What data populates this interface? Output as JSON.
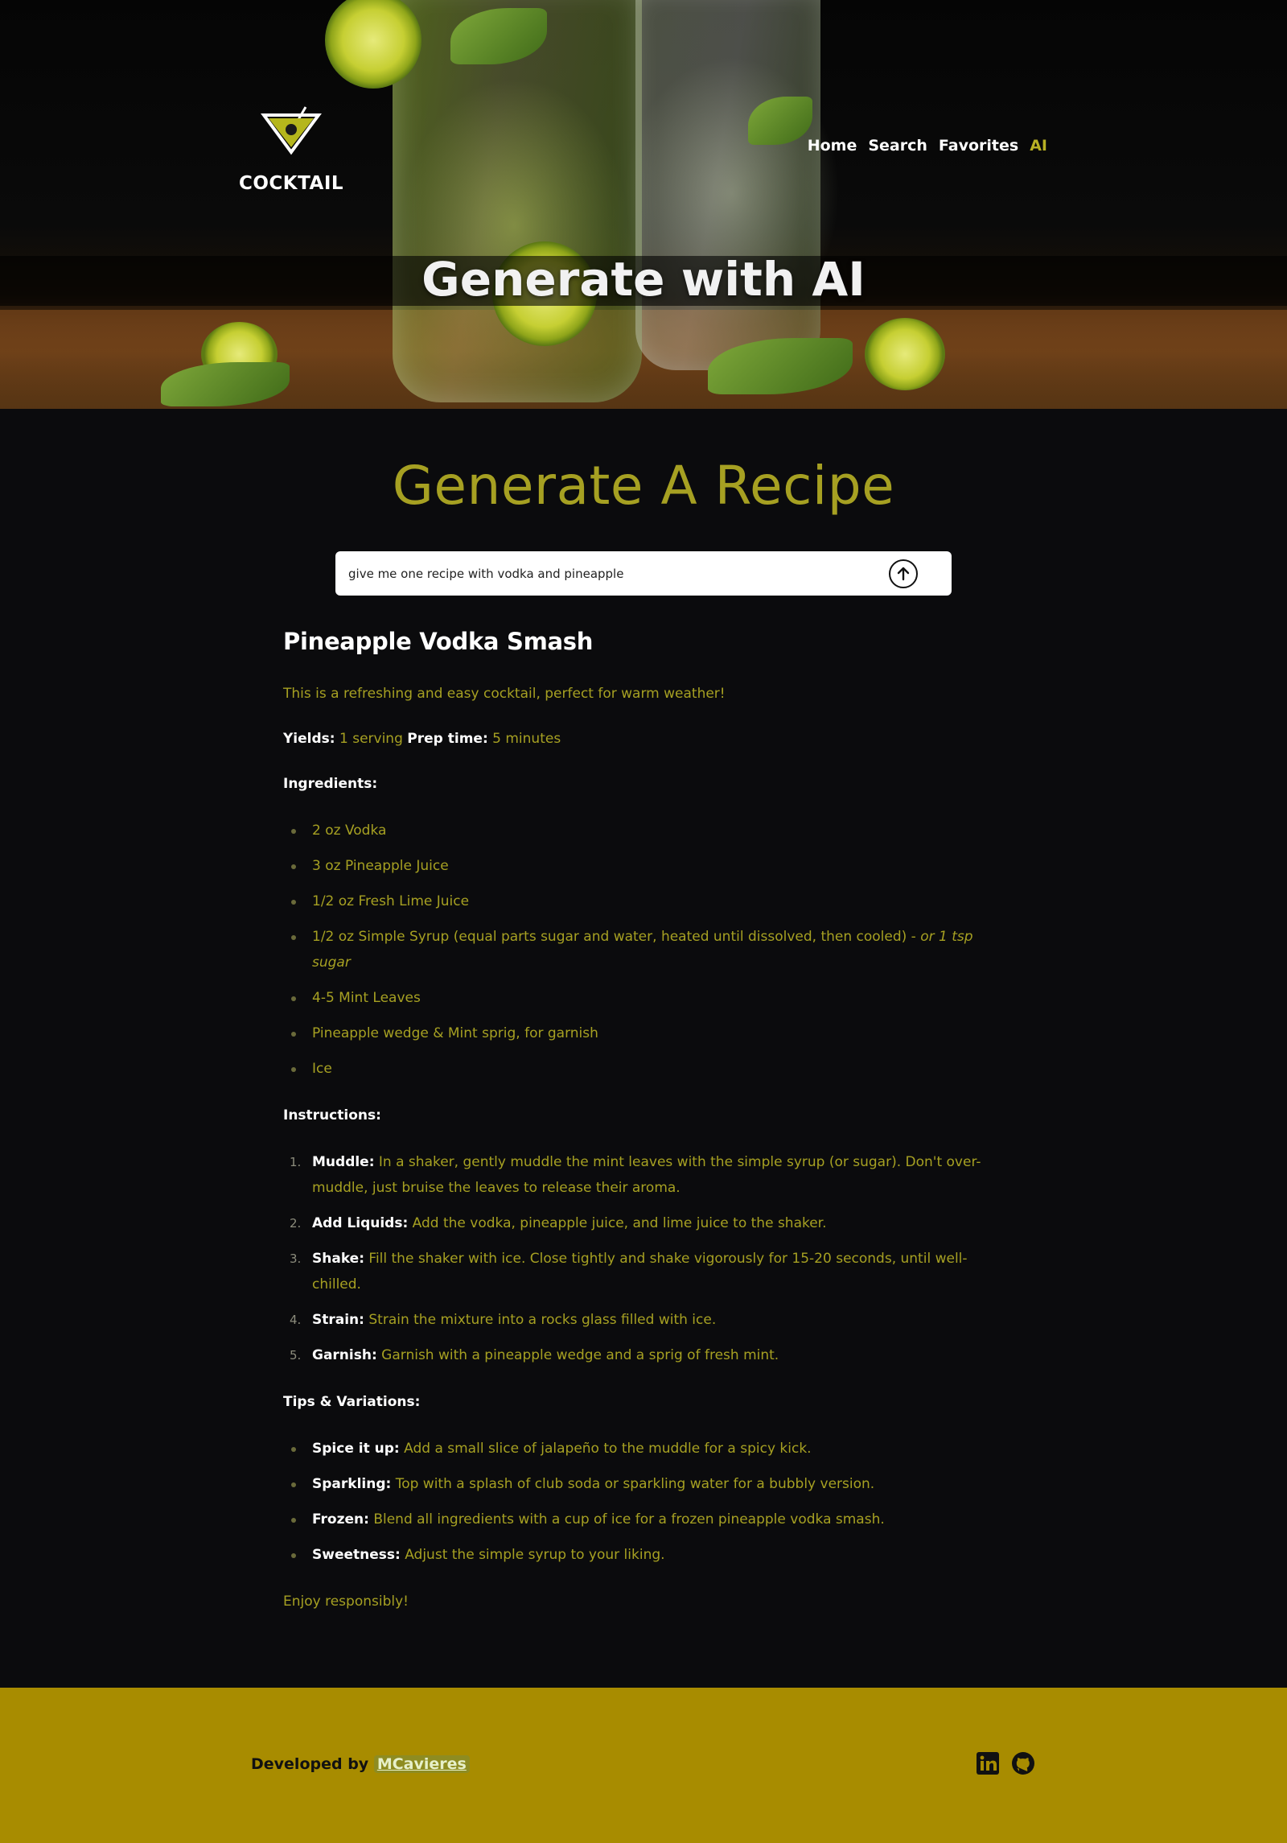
{
  "nav": {
    "logo_text": "COCKTAIL",
    "links": [
      {
        "label": "Home",
        "active": false
      },
      {
        "label": "Search",
        "active": false
      },
      {
        "label": "Favorites",
        "active": false
      },
      {
        "label": "AI",
        "active": true
      }
    ]
  },
  "hero": {
    "title": "Generate with AI"
  },
  "generator": {
    "title": "Generate A Recipe",
    "input_value": "give me one recipe with vodka and pineapple",
    "send_icon": "arrow-up-circle-icon"
  },
  "recipe": {
    "name": "Pineapple Vodka Smash",
    "description": "This is a refreshing and easy cocktail, perfect for warm weather!",
    "yields_label": "Yields:",
    "yields_value": "1 serving",
    "prep_label": "Prep time:",
    "prep_value": "5 minutes",
    "ingredients_heading": "Ingredients:",
    "ingredients": [
      "2 oz Vodka",
      "3 oz Pineapple Juice",
      "1/2 oz Fresh Lime Juice",
      "1/2 oz Simple Syrup (equal parts sugar and water, heated until dissolved, then cooled) - ",
      "4-5 Mint Leaves",
      "Pineapple wedge & Mint sprig, for garnish",
      "Ice"
    ],
    "ingredient_4_alt": "or 1 tsp sugar",
    "instructions_heading": "Instructions:",
    "instructions": [
      {
        "num": "1.",
        "label": "Muddle:",
        "text": " In a shaker, gently muddle the mint leaves with the simple syrup (or sugar). Don't over-muddle, just bruise the leaves to release their aroma."
      },
      {
        "num": "2.",
        "label": "Add Liquids:",
        "text": " Add the vodka, pineapple juice, and lime juice to the shaker."
      },
      {
        "num": "3.",
        "label": "Shake:",
        "text": " Fill the shaker with ice. Close tightly and shake vigorously for 15-20 seconds, until well-chilled."
      },
      {
        "num": "4.",
        "label": "Strain:",
        "text": " Strain the mixture into a rocks glass filled with ice."
      },
      {
        "num": "5.",
        "label": "Garnish:",
        "text": " Garnish with a pineapple wedge and a sprig of fresh mint."
      }
    ],
    "tips_heading": "Tips & Variations:",
    "tips": [
      {
        "label": "Spice it up:",
        "text": " Add a small slice of jalapeño to the muddle for a spicy kick."
      },
      {
        "label": "Sparkling:",
        "text": " Top with a splash of club soda or sparkling water for a bubbly version."
      },
      {
        "label": "Frozen:",
        "text": " Blend all ingredients with a cup of ice for a frozen pineapple vodka smash."
      },
      {
        "label": "Sweetness:",
        "text": " Adjust the simple syrup to your liking."
      }
    ],
    "closing": "Enjoy responsibly!"
  },
  "footer": {
    "credit_prefix": "Developed by ",
    "author": "MCavieres",
    "icons": [
      "linkedin-icon",
      "github-icon"
    ]
  },
  "colors": {
    "accent": "#a6a022",
    "nav_active": "#b8b024",
    "background": "#0b0b0d",
    "footer": "#a88c00"
  }
}
